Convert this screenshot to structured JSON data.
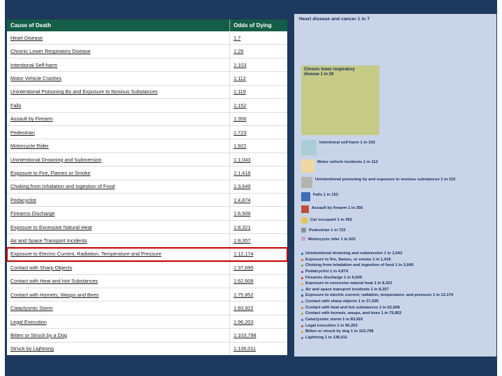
{
  "slide": {
    "background": "#1d3a5e",
    "page_background": "#ffffff"
  },
  "table": {
    "header_bg": "#145d46",
    "headers": [
      "Cause of Death",
      "Odds of Dying"
    ],
    "rows": [
      {
        "cause": "Heart Disease",
        "odds": "1:7"
      },
      {
        "cause": "Chronic Lower Respiratory Disease",
        "odds": "1:29"
      },
      {
        "cause": "Intentional Self-harm",
        "odds": "1:103"
      },
      {
        "cause": "Motor Vehicle Crashes",
        "odds": "1:112"
      },
      {
        "cause": "Unintentional Poisoning By and Exposure to Noxious Substances",
        "odds": "1:119"
      },
      {
        "cause": "Falls",
        "odds": "1:152"
      },
      {
        "cause": "Assault by Firearm",
        "odds": "1:356"
      },
      {
        "cause": "Pedestrian",
        "odds": "1:723"
      },
      {
        "cause": "Motorcycle Rider",
        "odds": "1:922"
      },
      {
        "cause": "Unintentional Drowning and Submersion",
        "odds": "1:1,043"
      },
      {
        "cause": "Exposure to Fire, Flames or Smoke",
        "odds": "1:1,418"
      },
      {
        "cause": "Choking from Inhalation and Ingestion of Food",
        "odds": "1:3,649"
      },
      {
        "cause": "Pedacyclist",
        "odds": "1:4,874"
      },
      {
        "cause": "Firearms Discharge",
        "odds": "1:6,509"
      },
      {
        "cause": "Exposure to Excessive Natural Heat",
        "odds": "1:8,321"
      },
      {
        "cause": "Air and Space Transport Incidents",
        "odds": "1:8,357"
      },
      {
        "cause": "Exposure to Electric Current, Radiation, Temperature and Pressure",
        "odds": "1:12,174",
        "highlighted": true
      },
      {
        "cause": "Contact with Sharp Objects",
        "odds": "1:37,695"
      },
      {
        "cause": "Contact with Heat and Hot Substances",
        "odds": "1:62,608"
      },
      {
        "cause": "Contact with Hornets, Wasps and Bees",
        "odds": "1:75,852"
      },
      {
        "cause": "Cataclysmic Storm",
        "odds": "1:83,922"
      },
      {
        "cause": "Legal Execution",
        "odds": "1:96,203"
      },
      {
        "cause": "Bitten or Struck by a Dog",
        "odds": "1:103,798"
      },
      {
        "cause": "Struck by Lightning",
        "odds": "1:136,011"
      }
    ]
  },
  "infographic": {
    "background": "#c9d4e8",
    "title": "Heart disease and cancer 1 in 7",
    "big_square": {
      "label": "Chronic lower respiratory disease 1 in 29",
      "color": "#c5cb85"
    },
    "squares": [
      {
        "label": "Intentional self-harm 1 in 103",
        "color": "#aacdd6",
        "size": 22
      },
      {
        "label": "Motor vehicle incidents 1 in 112",
        "color": "#f0d8a2",
        "size": 19
      },
      {
        "label": "Unintentional poisoning by and exposure to noxious substances 1 in 119",
        "color": "#b4b4ae",
        "size": 16
      },
      {
        "label": "Falls 1 in 152",
        "color": "#3d6db5",
        "size": 13
      },
      {
        "label": "Assault by firearm 1 in 356",
        "color": "#c14d3c",
        "size": 11
      },
      {
        "label": "Car occupant 1 in 492",
        "color": "#e5c558",
        "size": 9
      },
      {
        "label": "Pedestrian 1 in 723",
        "color": "#8d9297",
        "size": 7
      },
      {
        "label": "Motorcycle rider 1 in 922",
        "color": "#caa3c0",
        "size": 6
      }
    ],
    "bullets": [
      {
        "label": "Unintentional drowning and submersion 1 in 1,043",
        "color": "#2e7fba"
      },
      {
        "label": "Exposure to fire, flames, or smoke 1 in 1,418",
        "color": "#e0762f"
      },
      {
        "label": "Choking from inhalation and ingestion of food 1 in 3,649",
        "color": "#6fae44"
      },
      {
        "label": "Pedalcyclist 1 in 4,874",
        "color": "#9b59a0"
      },
      {
        "label": "Firearms discharge 1 in 6,509",
        "color": "#cc4b3a"
      },
      {
        "label": "Exposure to excessive natural heat 1 in 8,321",
        "color": "#e0b13a"
      },
      {
        "label": "Air and space transport incidents 1 in 8,357",
        "color": "#45b0a8"
      },
      {
        "label": "Exposure to electric current, radiation, temperature, and pressure 1 in 12,174",
        "color": "#3f5fa8"
      },
      {
        "label": "Contact with sharp objects 1 in 37,695",
        "color": "#8a8f94"
      },
      {
        "label": "Contact with heat and hot substances 1 in 62,608",
        "color": "#d98d3c"
      },
      {
        "label": "Contact with hornets, wasps, and bees 1 in 75,852",
        "color": "#a8b84b"
      },
      {
        "label": "Cataclysmic storm 1 in 83,922",
        "color": "#5b7fc4"
      },
      {
        "label": "Legal execution 1 in 96,203",
        "color": "#b85c5c"
      },
      {
        "label": "Bitten or struck by dog 1 in 103,798",
        "color": "#c9ac35"
      },
      {
        "label": "Lightning 1 in 136,011",
        "color": "#70818f"
      }
    ]
  },
  "chart_data": [
    {
      "type": "table",
      "title": "Odds of Dying by Cause of Death",
      "columns": [
        "Cause of Death",
        "Odds of Dying"
      ],
      "rows": [
        [
          "Heart Disease",
          "1:7"
        ],
        [
          "Chronic Lower Respiratory Disease",
          "1:29"
        ],
        [
          "Intentional Self-harm",
          "1:103"
        ],
        [
          "Motor Vehicle Crashes",
          "1:112"
        ],
        [
          "Unintentional Poisoning By and Exposure to Noxious Substances",
          "1:119"
        ],
        [
          "Falls",
          "1:152"
        ],
        [
          "Assault by Firearm",
          "1:356"
        ],
        [
          "Pedestrian",
          "1:723"
        ],
        [
          "Motorcycle Rider",
          "1:922"
        ],
        [
          "Unintentional Drowning and Submersion",
          "1:1,043"
        ],
        [
          "Exposure to Fire, Flames or Smoke",
          "1:1,418"
        ],
        [
          "Choking from Inhalation and Ingestion of Food",
          "1:3,649"
        ],
        [
          "Pedacyclist",
          "1:4,874"
        ],
        [
          "Firearms Discharge",
          "1:6,509"
        ],
        [
          "Exposure to Excessive Natural Heat",
          "1:8,321"
        ],
        [
          "Air and Space Transport Incidents",
          "1:8,357"
        ],
        [
          "Exposure to Electric Current, Radiation, Temperature and Pressure",
          "1:12,174"
        ],
        [
          "Contact with Sharp Objects",
          "1:37,695"
        ],
        [
          "Contact with Heat and Hot Substances",
          "1:62,608"
        ],
        [
          "Contact with Hornets, Wasps and Bees",
          "1:75,852"
        ],
        [
          "Cataclysmic Storm",
          "1:83,922"
        ],
        [
          "Legal Execution",
          "1:96,203"
        ],
        [
          "Bitten or Struck by a Dog",
          "1:103,798"
        ],
        [
          "Struck by Lightning",
          "1:136,011"
        ]
      ],
      "notes": "Row 'Exposure to Electric Current, Radiation, Temperature and Pressure' is highlighted with a red box"
    },
    {
      "type": "pie",
      "note": "proportional nested-squares infographic; values are N in 'odds 1 in N'",
      "title": "Heart disease and cancer 1 in 7",
      "categories": [
        "Heart disease and cancer",
        "Chronic lower respiratory disease",
        "Intentional self-harm",
        "Motor vehicle incidents",
        "Unintentional poisoning by and exposure to noxious substances",
        "Falls",
        "Assault by firearm",
        "Car occupant",
        "Pedestrian",
        "Motorcycle rider",
        "Unintentional drowning and submersion",
        "Exposure to fire, flames, or smoke",
        "Choking from inhalation and ingestion of food",
        "Pedalcyclist",
        "Firearms discharge",
        "Exposure to excessive natural heat",
        "Air and space transport incidents",
        "Exposure to electric current, radiation, temperature, and pressure",
        "Contact with sharp objects",
        "Contact with heat and hot substances",
        "Contact with hornets, wasps, and bees",
        "Cataclysmic storm",
        "Legal execution",
        "Bitten or struck by dog",
        "Lightning"
      ],
      "values": [
        7,
        29,
        103,
        112,
        119,
        152,
        356,
        492,
        723,
        922,
        1043,
        1418,
        3649,
        4874,
        6509,
        8321,
        8357,
        12174,
        37695,
        62608,
        75852,
        83922,
        96203,
        103798,
        136011
      ]
    }
  ]
}
